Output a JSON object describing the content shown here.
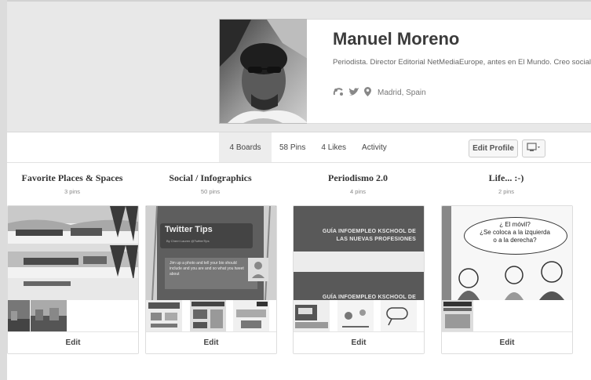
{
  "profile": {
    "name": "Manuel Moreno",
    "bio": "Periodista. Director Editorial NetMediaEurope, antes en El Mundo. Creo sociales, tengo mi propio blog y muchas ideas en la cabeza",
    "location": "Madrid, Spain"
  },
  "tabs": [
    {
      "label": "4 Boards",
      "active": true
    },
    {
      "label": "58 Pins",
      "active": false
    },
    {
      "label": "4 Likes",
      "active": false
    },
    {
      "label": "Activity",
      "active": false
    }
  ],
  "actions": {
    "edit_profile": "Edit Profile"
  },
  "boards": [
    {
      "title": "Favorite Places & Spaces",
      "count": "3 pins",
      "edit": "Edit"
    },
    {
      "title": "Social / Infographics",
      "count": "50 pins",
      "edit": "Edit",
      "cover_title": "Twitter Tips",
      "cover_sub": "By Cherri Lauren @TwitterTips",
      "cover_body": "Jim up a photo and tell your bio should include and you are and so what you tweet about"
    },
    {
      "title": "Periodismo 2.0",
      "count": "4 pins",
      "edit": "Edit",
      "cover_line1": "GUÍA INFOEMPLEO KSCHOOL DE",
      "cover_line2": "LAS NUEVAS PROFESIONES",
      "cover_line3": "GUÍA INFOEMPLEO KSCHOOL DE"
    },
    {
      "title": "Life... :-)",
      "count": "2 pins",
      "edit": "Edit",
      "bubble_line1": "¿ El móvil?",
      "bubble_line2": "¿Se coloca a la izquierda",
      "bubble_line3": "o a la derecha?"
    }
  ],
  "icons": [
    "connect-icon",
    "twitter-icon",
    "location-pin-icon",
    "message-icon"
  ]
}
